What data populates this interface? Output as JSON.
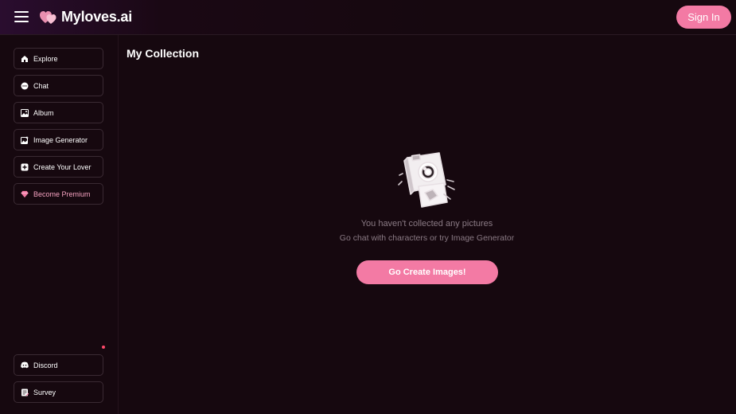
{
  "header": {
    "brand": "Myloves.ai",
    "signin_label": "Sign In"
  },
  "sidebar": {
    "items": [
      {
        "label": "Explore",
        "icon": "home-icon"
      },
      {
        "label": "Chat",
        "icon": "chat-icon"
      },
      {
        "label": "Album",
        "icon": "album-icon"
      },
      {
        "label": "Image Generator",
        "icon": "image-generator-icon"
      },
      {
        "label": "Create Your Lover",
        "icon": "plus-icon"
      },
      {
        "label": "Become Premium",
        "icon": "diamond-icon"
      }
    ],
    "bottom_items": [
      {
        "label": "Discord",
        "icon": "discord-icon"
      },
      {
        "label": "Survey",
        "icon": "survey-icon"
      }
    ]
  },
  "main": {
    "title": "My Collection",
    "empty_title": "You haven't collected any pictures",
    "empty_subtitle": "Go chat with characters or try Image Generator",
    "cta_label": "Go Create Images!"
  },
  "colors": {
    "background": "#16080f",
    "accent": "#f37aa4",
    "premium_text": "#f6a2c0",
    "muted_text": "#8a7a84"
  }
}
